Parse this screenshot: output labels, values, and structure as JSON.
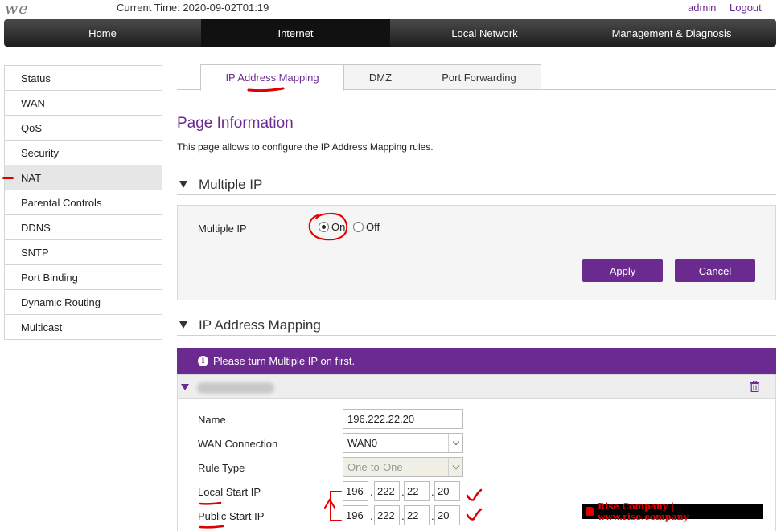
{
  "header": {
    "logo": "we",
    "current_time": "Current Time: 2020-09-02T01:19",
    "user_link": "admin",
    "logout_link": "Logout"
  },
  "nav": {
    "items": [
      "Home",
      "Internet",
      "Local Network",
      "Management & Diagnosis"
    ],
    "active": "Internet"
  },
  "sidebar": {
    "items": [
      "Status",
      "WAN",
      "QoS",
      "Security",
      "NAT",
      "Parental Controls",
      "DDNS",
      "SNTP",
      "Port Binding",
      "Dynamic Routing",
      "Multicast"
    ],
    "active": "NAT"
  },
  "tabs": {
    "items": [
      "IP Address Mapping",
      "DMZ",
      "Port Forwarding"
    ],
    "active": "IP Address Mapping"
  },
  "page": {
    "title": "Page Information",
    "description": "This page allows to configure the IP Address Mapping rules."
  },
  "multiple_ip": {
    "section_title": "Multiple IP",
    "field_label": "Multiple IP",
    "option_on": "On",
    "option_off": "Off",
    "selected": "On",
    "apply_label": "Apply",
    "cancel_label": "Cancel"
  },
  "mapping": {
    "section_title": "IP Address Mapping",
    "notice": "Please turn Multiple IP on first.",
    "fields": {
      "name_label": "Name",
      "name_value": "196.222.22.20",
      "wan_label": "WAN Connection",
      "wan_value": "WAN0",
      "rule_label": "Rule Type",
      "rule_value": "One-to-One",
      "local_label": "Local Start IP",
      "local_ip": [
        "196",
        "222",
        "22",
        "20"
      ],
      "public_label": "Public Start IP",
      "public_ip": [
        "196",
        "222",
        "22",
        "20"
      ]
    }
  },
  "watermark": "Rise Company | www.rise.company",
  "colors": {
    "accent": "#6b2a8f",
    "nav_bg": "#2b2b2b",
    "annotation": "#e00000"
  }
}
